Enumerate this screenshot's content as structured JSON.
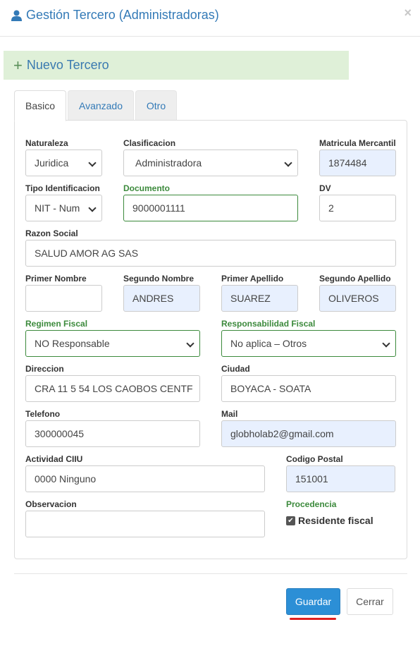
{
  "header": {
    "title": "Gestión Tercero (Administradoras)",
    "close_label": "×"
  },
  "banner": {
    "label": "Nuevo Tercero"
  },
  "tabs": [
    {
      "label": "Basico"
    },
    {
      "label": "Avanzado"
    },
    {
      "label": "Otro"
    }
  ],
  "form": {
    "naturaleza": {
      "label": "Naturaleza",
      "value": "Juridica"
    },
    "clasificacion": {
      "label": "Clasificacion",
      "value": "Administradora"
    },
    "matricula": {
      "label": "Matricula Mercantil",
      "value": "1874484"
    },
    "tipo_id": {
      "label": "Tipo Identificacion",
      "value": "NIT - Num"
    },
    "documento": {
      "label": "Documento",
      "value": "9000001111"
    },
    "dv": {
      "label": "DV",
      "value": "2"
    },
    "razon_social": {
      "label": "Razon Social",
      "value": "SALUD AMOR AG SAS"
    },
    "primer_nombre": {
      "label": "Primer Nombre",
      "value": ""
    },
    "segundo_nombre": {
      "label": "Segundo Nombre",
      "value": "ANDRES"
    },
    "primer_apellido": {
      "label": "Primer Apellido",
      "value": "SUAREZ"
    },
    "segundo_apellido": {
      "label": "Segundo Apellido",
      "value": "OLIVEROS"
    },
    "regimen_fiscal": {
      "label": "Regimen Fiscal",
      "value": "NO Responsable"
    },
    "responsabilidad_fiscal": {
      "label": "Responsabilidad Fiscal",
      "value": "No aplica – Otros"
    },
    "direccion": {
      "label": "Direccion",
      "value": "CRA 11 5 54 LOS CAOBOS CENTF"
    },
    "ciudad": {
      "label": "Ciudad",
      "value": "BOYACA - SOATA"
    },
    "telefono": {
      "label": "Telefono",
      "value": "300000045"
    },
    "mail": {
      "label": "Mail",
      "value": "globholab2@gmail.com"
    },
    "actividad_ciiu": {
      "label": "Actividad CIIU",
      "value": "0000 Ninguno"
    },
    "codigo_postal": {
      "label": "Codigo Postal",
      "value": "151001"
    },
    "observacion": {
      "label": "Observacion",
      "value": ""
    },
    "procedencia": {
      "label": "Procedencia",
      "checkbox_label": "Residente fiscal",
      "checked": true
    }
  },
  "footer": {
    "save_label": "Guardar",
    "close_label": "Cerrar"
  },
  "colors": {
    "link": "#337ab7",
    "banner_bg": "#dff0d8",
    "primary": "#2c8fd6",
    "autofill": "#e8f0fe",
    "valid_green": "#3c8a3c"
  }
}
